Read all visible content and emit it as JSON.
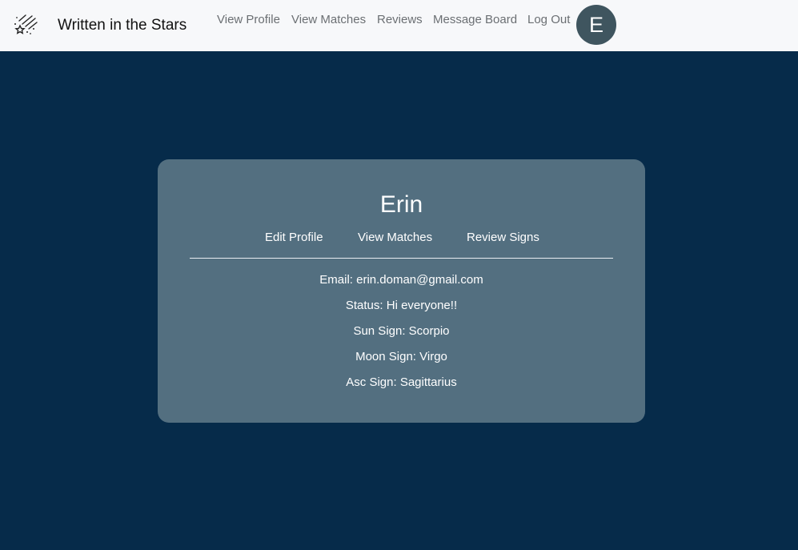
{
  "navbar": {
    "logo_icon": "shooting-stars-icon",
    "brand": "Written in the Stars",
    "links": [
      "View Profile",
      "View Matches",
      "Reviews",
      "Message Board",
      "Log Out"
    ],
    "avatar_initial": "E"
  },
  "profile": {
    "name": "Erin",
    "actions": [
      "Edit Profile",
      "View Matches",
      "Review Signs"
    ],
    "email": "Email: erin.doman@gmail.com",
    "status": "Status: Hi everyone!!",
    "sun_sign": "Sun Sign: Scorpio",
    "moon_sign": "Moon Sign: Virgo",
    "asc_sign": "Asc Sign: Sagittarius"
  },
  "colors": {
    "page_background": "#062b4a",
    "navbar_background": "#f7f8fa",
    "card_background": "#536f80",
    "avatar_background": "#3f555f",
    "nav_link": "#6b6f73"
  }
}
